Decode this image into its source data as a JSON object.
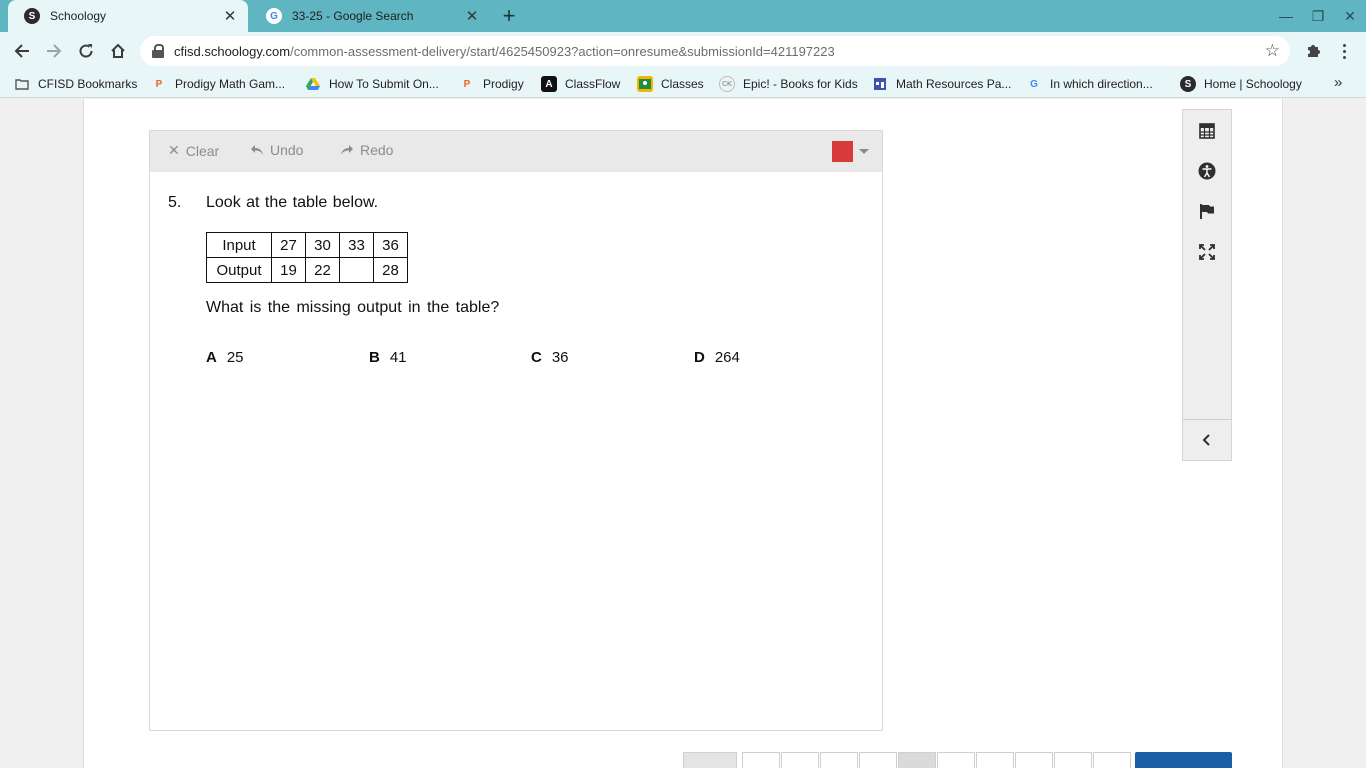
{
  "browser": {
    "tabs": [
      {
        "title": "Schoology",
        "favicon": "S",
        "active": true
      },
      {
        "title": "33-25 - Google Search",
        "favicon": "G",
        "active": false
      }
    ],
    "address": {
      "host": "cfisd.schoology.com",
      "path": "/common-assessment-delivery/start/4625450923?action=onresume&submissionId=421197223"
    },
    "bookmarks": [
      {
        "label": "CFISD Bookmarks",
        "icon": "folder-icon"
      },
      {
        "label": "Prodigy Math Gam...",
        "icon": "prodigy-icon"
      },
      {
        "label": "How To Submit On...",
        "icon": "google-drive-icon"
      },
      {
        "label": "Prodigy",
        "icon": "prodigy-icon"
      },
      {
        "label": "ClassFlow",
        "icon": "classflow-icon"
      },
      {
        "label": "Classes",
        "icon": "google-classroom-icon"
      },
      {
        "label": "Epic! - Books for Kids",
        "icon": "ck-icon"
      },
      {
        "label": "Math Resources Pa...",
        "icon": "calendar-page-icon"
      },
      {
        "label": "In which direction...",
        "icon": "google-icon"
      },
      {
        "label": "Home | Schoology",
        "icon": "schoology-icon"
      }
    ]
  },
  "draw_toolbar": {
    "clear": "Clear",
    "undo": "Undo",
    "redo": "Redo",
    "pen_color": "#d93b3b"
  },
  "question": {
    "number": "5.",
    "prompt": "Look at the table below.",
    "table": {
      "rows": [
        {
          "label": "Input",
          "values": [
            "27",
            "30",
            "33",
            "36"
          ]
        },
        {
          "label": "Output",
          "values": [
            "19",
            "22",
            "",
            "28"
          ]
        }
      ]
    },
    "ask": "What is the missing output in the table?",
    "choices": [
      {
        "letter": "A",
        "value": "25"
      },
      {
        "letter": "B",
        "value": "41"
      },
      {
        "letter": "C",
        "value": "36"
      },
      {
        "letter": "D",
        "value": "264"
      }
    ]
  },
  "colors": {
    "chrome_frame": "#5fb6c2",
    "chrome_toolbar": "#e9f6f8",
    "next_button": "#1a5fa6"
  }
}
